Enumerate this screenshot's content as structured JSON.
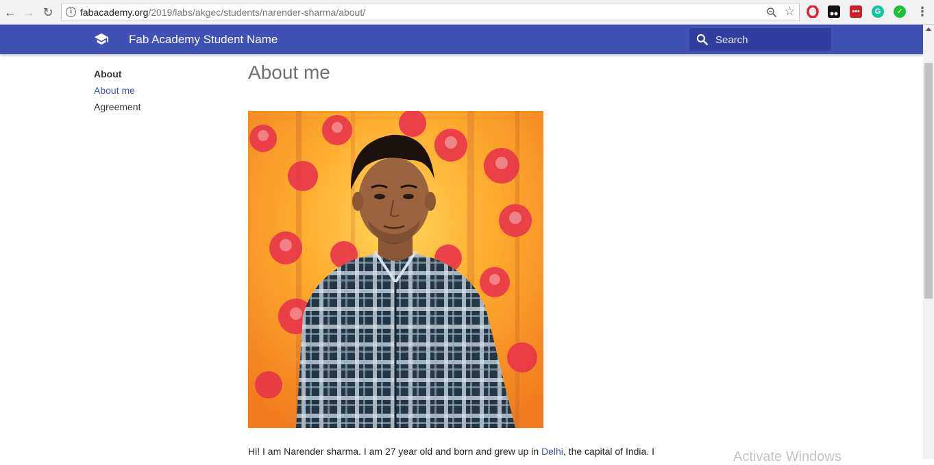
{
  "browser": {
    "url_domain": "fabacademy.org",
    "url_path": "/2019/labs/akgec/students/narender-sharma/about/",
    "extensions": [
      {
        "name": "opera-icon",
        "color": "#e0202a"
      },
      {
        "name": "tampermonkey-icon",
        "color": "#000000"
      },
      {
        "name": "lastpass-icon",
        "color": "#cc2029"
      },
      {
        "name": "grammarly-icon",
        "color": "#15c39a"
      },
      {
        "name": "checkmark-extension-icon",
        "color": "#1fbf3a"
      }
    ]
  },
  "header": {
    "site_title": "Fab Academy Student Name",
    "search_placeholder": "Search",
    "brand_color": "#3f51b5",
    "search_bg_color": "#303f9f"
  },
  "sidebar": {
    "section_title": "About",
    "items": [
      {
        "label": "About me",
        "active": true
      },
      {
        "label": "Agreement",
        "active": false
      }
    ]
  },
  "main": {
    "title": "About me",
    "intro_before_link": "Hi! I am Narender sharma. I am 27 year old and born and grew up in ",
    "intro_link": "Delhi",
    "intro_after_link": ", the capital of India. I"
  },
  "overlay": {
    "watermark": "Activate Windows"
  }
}
